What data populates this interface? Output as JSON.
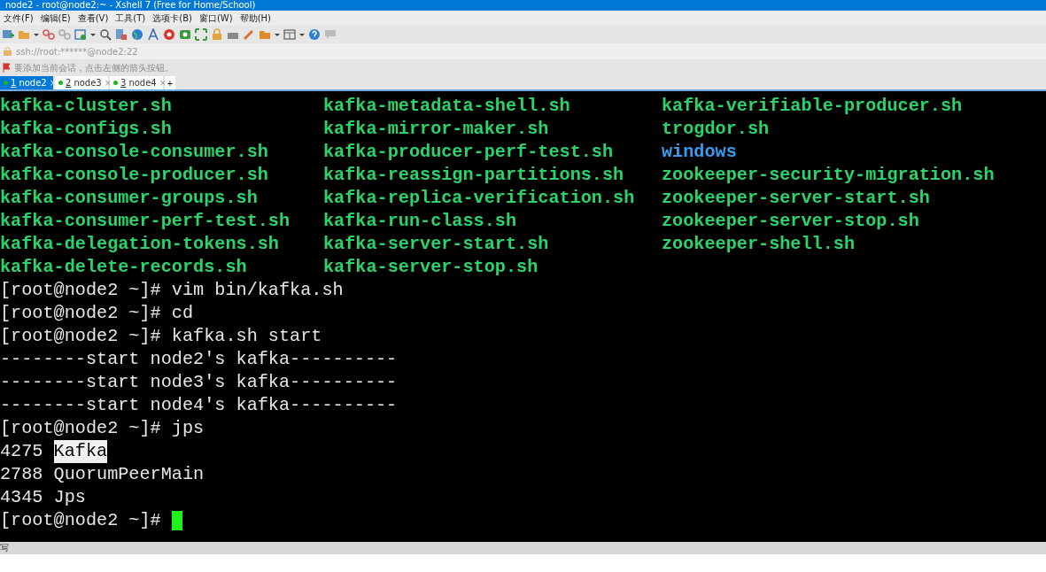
{
  "window": {
    "title": "node2 - root@node2:~ - Xshell 7 (Free for Home/School)"
  },
  "menu": [
    "文件(F)",
    "编辑(E)",
    "查看(V)",
    "工具(T)",
    "选项卡(B)",
    "窗口(W)",
    "帮助(H)"
  ],
  "address": "ssh://root:******@node2:22",
  "hint": "要添加当前会话，点击左侧的箭头按钮。",
  "tabs": [
    {
      "number": "1",
      "label": "node2",
      "close": "×",
      "selected": true
    },
    {
      "number": "2",
      "label": "node3",
      "close": "×",
      "selected": false
    },
    {
      "number": "3",
      "label": "node4",
      "close": "×",
      "selected": false
    }
  ],
  "new_tab": "+",
  "terminal": {
    "lines": [
      {
        "kind": "ls",
        "cells": [
          {
            "text": "kafka-cluster.sh",
            "kind": "exec"
          },
          {
            "text": "kafka-metadata-shell.sh",
            "kind": "exec"
          },
          {
            "text": "kafka-verifiable-producer.sh",
            "kind": "exec"
          }
        ]
      },
      {
        "kind": "ls",
        "cells": [
          {
            "text": "kafka-configs.sh",
            "kind": "exec"
          },
          {
            "text": "kafka-mirror-maker.sh",
            "kind": "exec"
          },
          {
            "text": "trogdor.sh",
            "kind": "exec"
          }
        ]
      },
      {
        "kind": "ls",
        "cells": [
          {
            "text": "kafka-console-consumer.sh",
            "kind": "exec"
          },
          {
            "text": "kafka-producer-perf-test.sh",
            "kind": "exec"
          },
          {
            "text": "windows",
            "kind": "dir"
          }
        ]
      },
      {
        "kind": "ls",
        "cells": [
          {
            "text": "kafka-console-producer.sh",
            "kind": "exec"
          },
          {
            "text": "kafka-reassign-partitions.sh",
            "kind": "exec"
          },
          {
            "text": "zookeeper-security-migration.sh",
            "kind": "exec"
          }
        ]
      },
      {
        "kind": "ls",
        "cells": [
          {
            "text": "kafka-consumer-groups.sh",
            "kind": "exec"
          },
          {
            "text": "kafka-replica-verification.sh",
            "kind": "exec"
          },
          {
            "text": "zookeeper-server-start.sh",
            "kind": "exec"
          }
        ]
      },
      {
        "kind": "ls",
        "cells": [
          {
            "text": "kafka-consumer-perf-test.sh",
            "kind": "exec"
          },
          {
            "text": "kafka-run-class.sh",
            "kind": "exec"
          },
          {
            "text": "zookeeper-server-stop.sh",
            "kind": "exec"
          }
        ]
      },
      {
        "kind": "ls",
        "cells": [
          {
            "text": "kafka-delegation-tokens.sh",
            "kind": "exec"
          },
          {
            "text": "kafka-server-start.sh",
            "kind": "exec"
          },
          {
            "text": "zookeeper-shell.sh",
            "kind": "exec"
          }
        ]
      },
      {
        "kind": "ls",
        "cells": [
          {
            "text": "kafka-delete-records.sh",
            "kind": "exec"
          },
          {
            "text": "kafka-server-stop.sh",
            "kind": "exec"
          }
        ]
      },
      {
        "kind": "text",
        "cursor": false,
        "parts": [
          {
            "text": "[root@node2 ~]# vim bin/kafka.sh",
            "selected": false
          }
        ]
      },
      {
        "kind": "text",
        "cursor": false,
        "parts": [
          {
            "text": "[root@node2 ~]# cd",
            "selected": false
          }
        ]
      },
      {
        "kind": "text",
        "cursor": false,
        "parts": [
          {
            "text": "[root@node2 ~]# kafka.sh start",
            "selected": false
          }
        ]
      },
      {
        "kind": "text",
        "cursor": false,
        "parts": [
          {
            "text": "--------start node2's kafka----------",
            "selected": false
          }
        ]
      },
      {
        "kind": "text",
        "cursor": false,
        "parts": [
          {
            "text": "--------start node3's kafka----------",
            "selected": false
          }
        ]
      },
      {
        "kind": "text",
        "cursor": false,
        "parts": [
          {
            "text": "--------start node4's kafka----------",
            "selected": false
          }
        ]
      },
      {
        "kind": "text",
        "cursor": false,
        "parts": [
          {
            "text": "[root@node2 ~]# jps",
            "selected": false
          }
        ]
      },
      {
        "kind": "text",
        "cursor": false,
        "parts": [
          {
            "text": "4275 ",
            "selected": false
          },
          {
            "text": "Kafka",
            "selected": true
          }
        ]
      },
      {
        "kind": "text",
        "cursor": false,
        "parts": [
          {
            "text": "2788 QuorumPeerMain",
            "selected": false
          }
        ]
      },
      {
        "kind": "text",
        "cursor": false,
        "parts": [
          {
            "text": "4345 Jps",
            "selected": false
          }
        ]
      },
      {
        "kind": "text",
        "cursor": true,
        "parts": [
          {
            "text": "[root@node2 ~]# ",
            "selected": false
          }
        ]
      }
    ]
  },
  "compose_bar": {
    "label": "写"
  }
}
